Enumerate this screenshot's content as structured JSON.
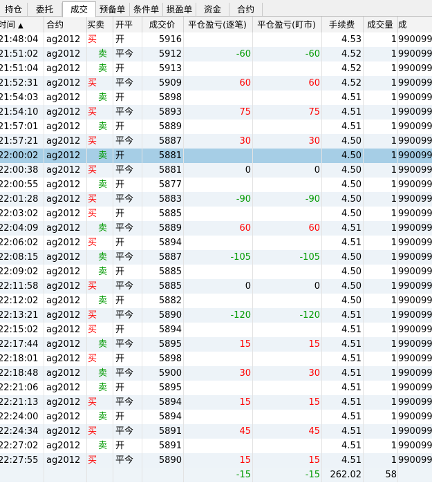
{
  "tabs": [
    "持仓",
    "委托",
    "成交",
    "预备单",
    "条件单",
    "损盈单",
    "资金",
    "合约"
  ],
  "active_tab": "成交",
  "columns": {
    "time": "时间",
    "sort_indicator": "▲",
    "symbol": "合约",
    "buy_sell": "买卖",
    "open_close": "开平",
    "price": "成交价",
    "pnl_trade": "平仓盈亏(逐笔)",
    "pnl_mark": "平仓盈亏(盯市)",
    "fee": "手续费",
    "volume": "成交量",
    "extra": "成"
  },
  "rows": [
    {
      "time": "21:48:04",
      "symbol": "ag2012",
      "bs": "买",
      "oc": "开",
      "price": "5916",
      "pnl1": "",
      "pnl2": "",
      "fee": "4.53",
      "vol": "1",
      "no": "990099"
    },
    {
      "time": "21:51:02",
      "symbol": "ag2012",
      "bs": "卖",
      "oc": "平今",
      "price": "5912",
      "pnl1": "-60",
      "pnl2": "-60",
      "fee": "4.52",
      "vol": "1",
      "no": "990099"
    },
    {
      "time": "21:51:04",
      "symbol": "ag2012",
      "bs": "卖",
      "oc": "开",
      "price": "5913",
      "pnl1": "",
      "pnl2": "",
      "fee": "4.52",
      "vol": "1",
      "no": "990099"
    },
    {
      "time": "21:52:31",
      "symbol": "ag2012",
      "bs": "买",
      "oc": "平今",
      "price": "5909",
      "pnl1": "60",
      "pnl2": "60",
      "fee": "4.52",
      "vol": "1",
      "no": "990099"
    },
    {
      "time": "21:54:03",
      "symbol": "ag2012",
      "bs": "卖",
      "oc": "开",
      "price": "5898",
      "pnl1": "",
      "pnl2": "",
      "fee": "4.51",
      "vol": "1",
      "no": "990099"
    },
    {
      "time": "21:54:10",
      "symbol": "ag2012",
      "bs": "买",
      "oc": "平今",
      "price": "5893",
      "pnl1": "75",
      "pnl2": "75",
      "fee": "4.51",
      "vol": "1",
      "no": "990099"
    },
    {
      "time": "21:57:01",
      "symbol": "ag2012",
      "bs": "卖",
      "oc": "开",
      "price": "5889",
      "pnl1": "",
      "pnl2": "",
      "fee": "4.51",
      "vol": "1",
      "no": "990099"
    },
    {
      "time": "21:57:21",
      "symbol": "ag2012",
      "bs": "买",
      "oc": "平今",
      "price": "5887",
      "pnl1": "30",
      "pnl2": "30",
      "fee": "4.50",
      "vol": "1",
      "no": "990099"
    },
    {
      "time": "22:00:02",
      "symbol": "ag2012",
      "bs": "卖",
      "oc": "开",
      "price": "5881",
      "pnl1": "",
      "pnl2": "",
      "fee": "4.50",
      "vol": "1",
      "no": "990099",
      "selected": true
    },
    {
      "time": "22:00:38",
      "symbol": "ag2012",
      "bs": "买",
      "oc": "平今",
      "price": "5881",
      "pnl1": "0",
      "pnl2": "0",
      "fee": "4.50",
      "vol": "1",
      "no": "990099"
    },
    {
      "time": "22:00:55",
      "symbol": "ag2012",
      "bs": "卖",
      "oc": "开",
      "price": "5877",
      "pnl1": "",
      "pnl2": "",
      "fee": "4.50",
      "vol": "1",
      "no": "990099"
    },
    {
      "time": "22:01:28",
      "symbol": "ag2012",
      "bs": "买",
      "oc": "平今",
      "price": "5883",
      "pnl1": "-90",
      "pnl2": "-90",
      "fee": "4.50",
      "vol": "1",
      "no": "990099"
    },
    {
      "time": "22:03:02",
      "symbol": "ag2012",
      "bs": "买",
      "oc": "开",
      "price": "5885",
      "pnl1": "",
      "pnl2": "",
      "fee": "4.50",
      "vol": "1",
      "no": "990099"
    },
    {
      "time": "22:04:09",
      "symbol": "ag2012",
      "bs": "卖",
      "oc": "平今",
      "price": "5889",
      "pnl1": "60",
      "pnl2": "60",
      "fee": "4.51",
      "vol": "1",
      "no": "990099"
    },
    {
      "time": "22:06:02",
      "symbol": "ag2012",
      "bs": "买",
      "oc": "开",
      "price": "5894",
      "pnl1": "",
      "pnl2": "",
      "fee": "4.51",
      "vol": "1",
      "no": "990099"
    },
    {
      "time": "22:08:15",
      "symbol": "ag2012",
      "bs": "卖",
      "oc": "平今",
      "price": "5887",
      "pnl1": "-105",
      "pnl2": "-105",
      "fee": "4.50",
      "vol": "1",
      "no": "990099"
    },
    {
      "time": "22:09:02",
      "symbol": "ag2012",
      "bs": "卖",
      "oc": "开",
      "price": "5885",
      "pnl1": "",
      "pnl2": "",
      "fee": "4.50",
      "vol": "1",
      "no": "990099"
    },
    {
      "time": "22:11:58",
      "symbol": "ag2012",
      "bs": "买",
      "oc": "平今",
      "price": "5885",
      "pnl1": "0",
      "pnl2": "0",
      "fee": "4.50",
      "vol": "1",
      "no": "990099"
    },
    {
      "time": "22:12:02",
      "symbol": "ag2012",
      "bs": "卖",
      "oc": "开",
      "price": "5882",
      "pnl1": "",
      "pnl2": "",
      "fee": "4.50",
      "vol": "1",
      "no": "990099"
    },
    {
      "time": "22:13:21",
      "symbol": "ag2012",
      "bs": "买",
      "oc": "平今",
      "price": "5890",
      "pnl1": "-120",
      "pnl2": "-120",
      "fee": "4.51",
      "vol": "1",
      "no": "990099"
    },
    {
      "time": "22:15:02",
      "symbol": "ag2012",
      "bs": "买",
      "oc": "开",
      "price": "5894",
      "pnl1": "",
      "pnl2": "",
      "fee": "4.51",
      "vol": "1",
      "no": "990099"
    },
    {
      "time": "22:17:44",
      "symbol": "ag2012",
      "bs": "卖",
      "oc": "平今",
      "price": "5895",
      "pnl1": "15",
      "pnl2": "15",
      "fee": "4.51",
      "vol": "1",
      "no": "990099"
    },
    {
      "time": "22:18:01",
      "symbol": "ag2012",
      "bs": "买",
      "oc": "开",
      "price": "5898",
      "pnl1": "",
      "pnl2": "",
      "fee": "4.51",
      "vol": "1",
      "no": "990099"
    },
    {
      "time": "22:18:48",
      "symbol": "ag2012",
      "bs": "卖",
      "oc": "平今",
      "price": "5900",
      "pnl1": "30",
      "pnl2": "30",
      "fee": "4.51",
      "vol": "1",
      "no": "990099"
    },
    {
      "time": "22:21:06",
      "symbol": "ag2012",
      "bs": "卖",
      "oc": "开",
      "price": "5895",
      "pnl1": "",
      "pnl2": "",
      "fee": "4.51",
      "vol": "1",
      "no": "990099"
    },
    {
      "time": "22:21:13",
      "symbol": "ag2012",
      "bs": "买",
      "oc": "平今",
      "price": "5894",
      "pnl1": "15",
      "pnl2": "15",
      "fee": "4.51",
      "vol": "1",
      "no": "990099"
    },
    {
      "time": "22:24:00",
      "symbol": "ag2012",
      "bs": "卖",
      "oc": "开",
      "price": "5894",
      "pnl1": "",
      "pnl2": "",
      "fee": "4.51",
      "vol": "1",
      "no": "990099"
    },
    {
      "time": "22:24:34",
      "symbol": "ag2012",
      "bs": "买",
      "oc": "平今",
      "price": "5891",
      "pnl1": "45",
      "pnl2": "45",
      "fee": "4.51",
      "vol": "1",
      "no": "990099"
    },
    {
      "time": "22:27:02",
      "symbol": "ag2012",
      "bs": "卖",
      "oc": "开",
      "price": "5891",
      "pnl1": "",
      "pnl2": "",
      "fee": "4.51",
      "vol": "1",
      "no": "990099"
    },
    {
      "time": "22:27:55",
      "symbol": "ag2012",
      "bs": "买",
      "oc": "平今",
      "price": "5890",
      "pnl1": "15",
      "pnl2": "15",
      "fee": "4.51",
      "vol": "1",
      "no": "990099"
    }
  ],
  "totals": {
    "pnl1": "-15",
    "pnl2": "-15",
    "fee": "262.02",
    "vol": "58"
  },
  "colors": {
    "buy": "#ff0000",
    "sell": "#009a00",
    "selected_row": "#a6cee6",
    "alt_row": "#edf3f8"
  }
}
